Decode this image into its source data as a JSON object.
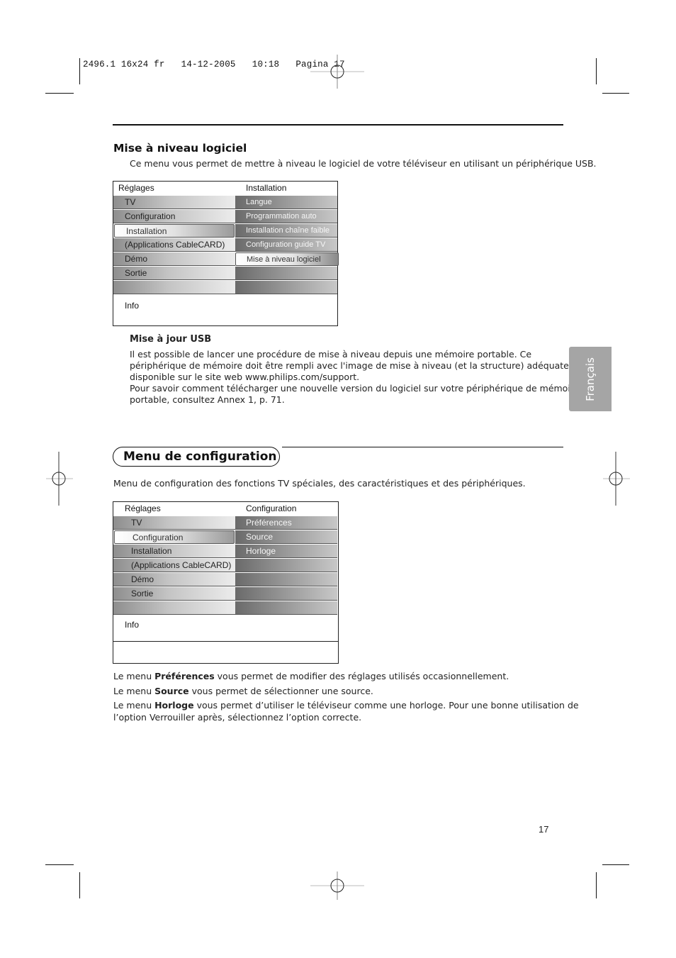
{
  "print_slug": "2496.1 16x24 fr   14-12-2005   10:18   Pagina 17",
  "side_tab": "Français",
  "section1": {
    "heading": "Mise à niveau logiciel",
    "intro": "Ce menu vous permet de mettre à niveau le logiciel de votre téléviseur en utilisant un périphérique USB.",
    "menu": {
      "left_header": "Réglages",
      "right_header": "Installation",
      "left_items": [
        "TV",
        "Configuration",
        "Installation",
        "(Applications CableCARD)",
        "Démo",
        "Sortie",
        ""
      ],
      "left_selected": 2,
      "right_items": [
        "Langue",
        "Programmation auto",
        "Installation chaîne faible",
        "Configuration guide TV",
        "Mise à niveau logiciel",
        "",
        ""
      ],
      "right_selected": 4,
      "info_label": "Info"
    },
    "subheading": "Mise à jour USB",
    "para1": "Il est possible de lancer une procédure de mise à niveau depuis une mémoire portable. Ce",
    "para2": "périphérique de mémoire doit être rempli avec l'image de mise à niveau (et la structure) adéquate,",
    "para3": "disponible sur le site web www.philips.com/support.",
    "para4": "Pour savoir comment télécharger une nouvelle version du logiciel sur votre périphérique de mémoire",
    "para5": "portable, consultez Annex 1, p. 71."
  },
  "section2": {
    "title": "Menu de configuration",
    "intro": "Menu de configuration des fonctions TV spéciales, des caractéristiques et des périphériques.",
    "menu": {
      "left_header": "Réglages",
      "right_header": "Configuration",
      "left_items": [
        "TV",
        "Configuration",
        "Installation",
        "(Applications CableCARD)",
        "Démo",
        "Sortie",
        ""
      ],
      "left_selected": 1,
      "right_items": [
        "Préférences",
        "Source",
        "Horloge",
        "",
        "",
        "",
        ""
      ],
      "info_label": "Info"
    },
    "lines": [
      {
        "prefix": "Le menu ",
        "bold": "Préférences",
        "rest": " vous permet de modifier des réglages utilisés occasionnellement."
      },
      {
        "prefix": "Le menu ",
        "bold": "Source",
        "rest": " vous permet de sélectionner une source."
      },
      {
        "prefix": "Le menu ",
        "bold": "Horloge",
        "rest": " vous permet d’utiliser le téléviseur comme une horloge. Pour une bonne utilisation de"
      }
    ],
    "last_line": "l’option Verrouiller après, sélectionnez l’option correcte."
  },
  "page_number": "17"
}
